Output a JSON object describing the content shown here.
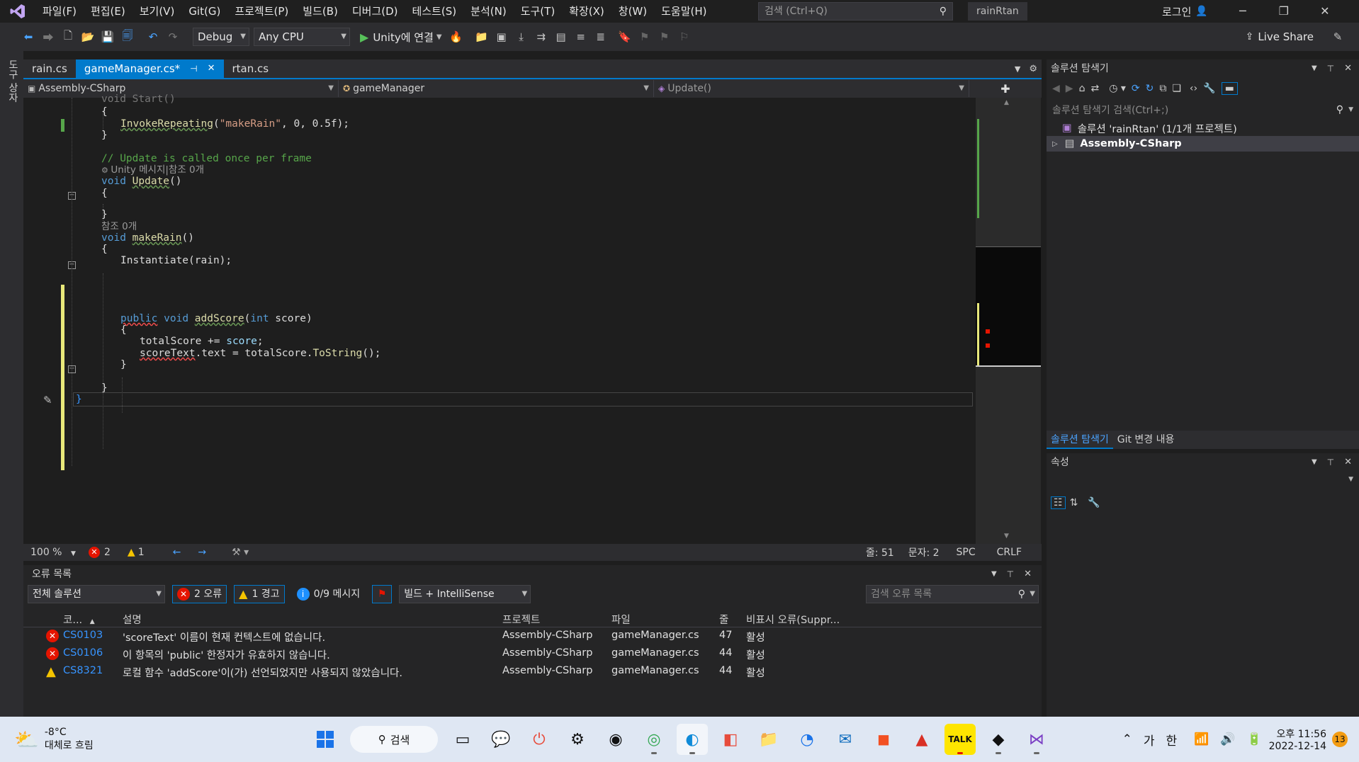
{
  "title_bar": {
    "menus": [
      "파일(F)",
      "편집(E)",
      "보기(V)",
      "Git(G)",
      "프로젝트(P)",
      "빌드(B)",
      "디버그(D)",
      "테스트(S)",
      "분석(N)",
      "도구(T)",
      "확장(X)",
      "창(W)",
      "도움말(H)"
    ],
    "search_placeholder": "검색 (Ctrl+Q)",
    "solution_name": "rainRtan",
    "login_label": "로그인"
  },
  "toolbar": {
    "config": "Debug",
    "platform": "Any CPU",
    "run_label": "Unity에 연결",
    "live_share": "Live Share"
  },
  "left_strip_label": "도구 상자",
  "tabs": [
    {
      "label": "rain.cs"
    },
    {
      "label": "gameManager.cs*"
    },
    {
      "label": "rtan.cs"
    }
  ],
  "nav": {
    "project": "Assembly-CSharp",
    "class": "gameManager",
    "member": "Update()"
  },
  "code": {
    "l1": "void Start()",
    "l2": "{",
    "l3_fn": "InvokeRepeating",
    "l3_str": "\"makeRain\"",
    "l3_rest": ", 0, 0.5f);",
    "l4": "}",
    "l5": "// Update is called once per frame",
    "l6": "Unity 메시지|참조 0개",
    "l7_kw": "void",
    "l7_fn": "Update",
    "l7_rest": "()",
    "l8": "{",
    "l9": "}",
    "l10": "참조 0개",
    "l11_kw": "void",
    "l11_fn": "makeRain",
    "l11_rest": "()",
    "l12": "{",
    "l13": "Instantiate(rain);",
    "l14_kw1": "public",
    "l14_kw2": "void",
    "l14_fn": "addScore",
    "l14_rest1": "(",
    "l14_kw3": "int",
    "l14_rest2": " score)",
    "l15": "{",
    "l16_a": "totalScore += ",
    "l16_b": "score",
    "l16_c": ";",
    "l17_a": "scoreText",
    "l17_b": ".text = totalScore.",
    "l17_c": "ToString",
    "l17_d": "();",
    "l18": "}",
    "l19": "}",
    "l20": "}"
  },
  "editor_status": {
    "zoom": "100 %",
    "errors": "2",
    "warnings": "1",
    "line": "줄: 51",
    "col": "문자: 2",
    "spc": "SPC",
    "eol": "CRLF"
  },
  "error_list": {
    "title": "오류 목록",
    "scope": "전체 솔루션",
    "errors_btn": "2 오류",
    "warnings_btn": "1 경고",
    "messages_btn": "0/9 메시지",
    "build_filter": "빌드 + IntelliSense",
    "search_placeholder": "검색 오류 목록",
    "columns": [
      "코...",
      "설명",
      "프로젝트",
      "파일",
      "줄",
      "비표시 오류(Suppr..."
    ],
    "rows": [
      {
        "code": "CS0103",
        "desc": "'scoreText' 이름이 현재 컨텍스트에 없습니다.",
        "project": "Assembly-CSharp",
        "file": "gameManager.cs",
        "line": "47",
        "state": "활성",
        "severity": "error"
      },
      {
        "code": "CS0106",
        "desc": "이 항목의 'public' 한정자가 유효하지 않습니다.",
        "project": "Assembly-CSharp",
        "file": "gameManager.cs",
        "line": "44",
        "state": "활성",
        "severity": "error"
      },
      {
        "code": "CS8321",
        "desc": "로컬 함수 'addScore'이(가) 선언되었지만 사용되지 않았습니다.",
        "project": "Assembly-CSharp",
        "file": "gameManager.cs",
        "line": "44",
        "state": "활성",
        "severity": "warning"
      }
    ]
  },
  "solution_explorer": {
    "title": "솔루션 탐색기",
    "search_placeholder": "솔루션 탐색기 검색(Ctrl+;)",
    "solution_item": "솔루션 'rainRtan' (1/1개 프로젝트)",
    "project_item": "Assembly-CSharp",
    "tab_solution": "솔루션 탐색기",
    "tab_git": "Git 변경 내용"
  },
  "properties": {
    "title": "속성"
  },
  "taskbar": {
    "weather_temp": "-8°C",
    "weather_desc": "대체로 흐림",
    "search_label": "검색",
    "ime_label": "가",
    "ime_label2": "한",
    "time": "오후 11:56",
    "date": "2022-12-14",
    "notif_count": "13"
  },
  "colors": {
    "accent": "#007acc",
    "error": "#e51400",
    "warning": "#f5c400",
    "change_saved": "#57a64a",
    "change_unsaved": "#e8e87a"
  }
}
